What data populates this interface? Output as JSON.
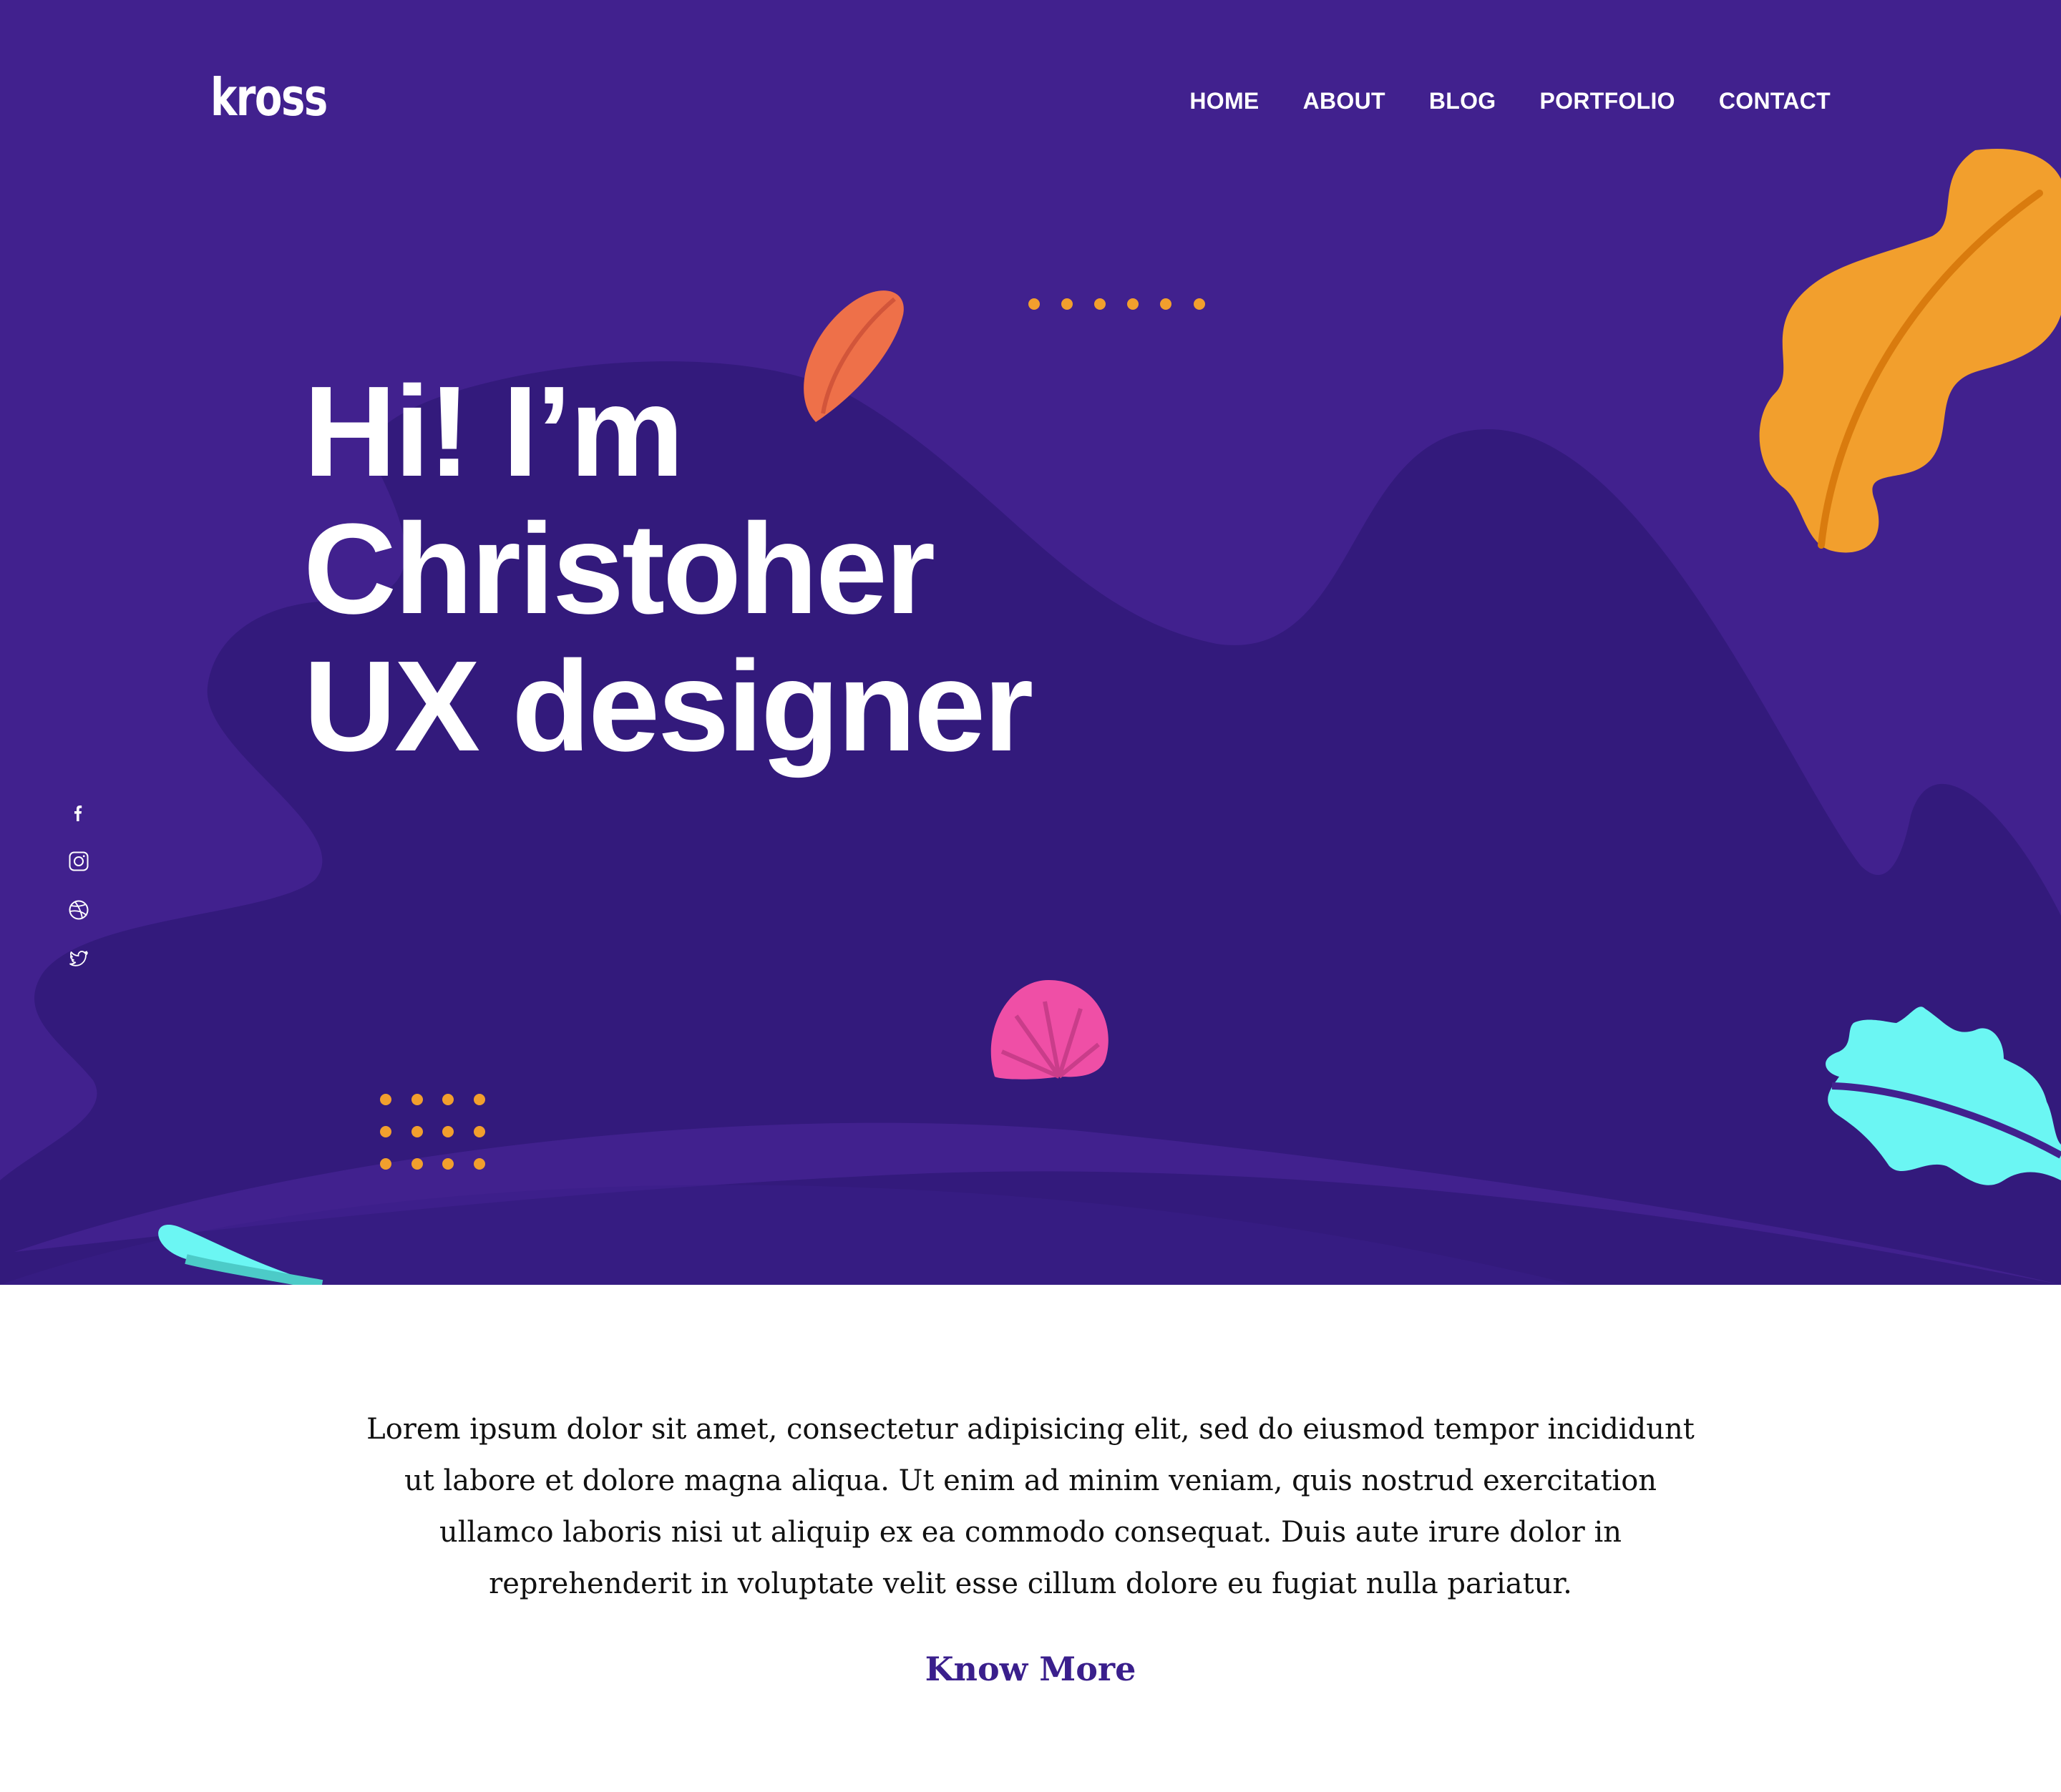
{
  "header": {
    "logo_text": "kross",
    "nav": [
      {
        "label": "HOME"
      },
      {
        "label": "ABOUT"
      },
      {
        "label": "BLOG"
      },
      {
        "label": "PORTFOLIO"
      },
      {
        "label": "CONTACT"
      }
    ]
  },
  "hero": {
    "headline_lines": [
      "Hi! I’m",
      "Christoher",
      "UX designer"
    ],
    "social_icons": [
      "facebook-icon",
      "instagram-icon",
      "dribbble-icon",
      "twitter-icon"
    ]
  },
  "colors": {
    "hero_bg": "#41218e",
    "hero_dark": "#331a7c",
    "orange": "#f29f2d",
    "coral": "#ee7049",
    "pink": "#ef4fa6",
    "cyan": "#6bf6f3",
    "link": "#3a1f8c"
  },
  "intro": {
    "text": "Lorem ipsum dolor sit amet, consectetur adipisicing elit, sed do eiusmod tempor incididunt ut labore et dolore magna aliqua. Ut enim ad minim veniam, quis nostrud exercitation ullamco laboris nisi ut aliquip ex ea commodo consequat. Duis aute irure dolor in reprehenderit in voluptate velit esse cillum dolore eu fugiat nulla pariatur.",
    "cta_label": "Know More"
  }
}
